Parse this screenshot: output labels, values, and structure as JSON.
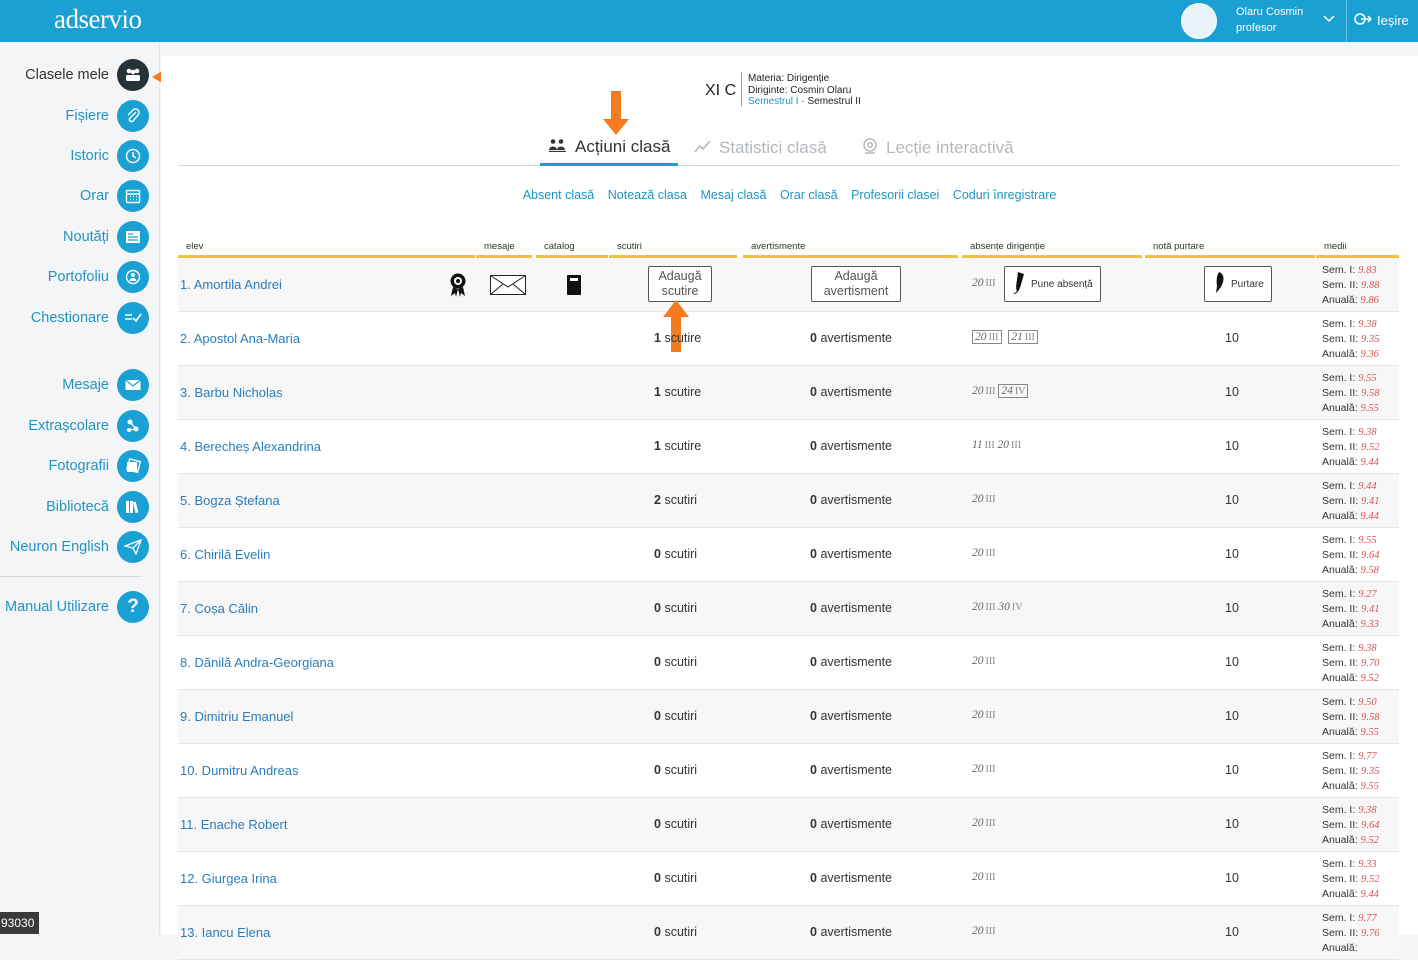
{
  "header": {
    "logo": "adservio",
    "user_name": "Olaru Cosmin",
    "user_role": "profesor",
    "logout": "Ieșire",
    "brand_color": "#1ba0d4"
  },
  "sidebar": {
    "items": [
      {
        "label": "Clasele mele",
        "icon": "classes-icon",
        "active": true
      },
      {
        "label": "Fișiere",
        "icon": "paperclip-icon"
      },
      {
        "label": "Istoric",
        "icon": "history-icon"
      },
      {
        "label": "Orar",
        "icon": "calendar-icon"
      },
      {
        "label": "Noutăți",
        "icon": "news-icon"
      },
      {
        "label": "Portofoliu",
        "icon": "portfolio-icon"
      },
      {
        "label": "Chestionare",
        "icon": "quiz-icon"
      },
      {
        "label": "Mesaje",
        "icon": "mail-icon"
      },
      {
        "label": "Extrașcolare",
        "icon": "extracurricular-icon"
      },
      {
        "label": "Fotografii",
        "icon": "photo-icon"
      },
      {
        "label": "Bibliotecă",
        "icon": "library-icon"
      },
      {
        "label": "Neuron English",
        "icon": "paper-plane-icon"
      },
      {
        "label": "Manual Utilizare",
        "icon": "help-icon"
      }
    ]
  },
  "class_info": {
    "name": "XI C",
    "subject": "Materia: Dirigenție",
    "head_teacher": "Diriginte: Cosmin Olaru",
    "semester_1": "Semestrul I",
    "separator": " · ",
    "semester_2": "Semestrul II"
  },
  "tabs": [
    {
      "label": "Acțiuni clasă",
      "active": true
    },
    {
      "label": "Statistici clasă"
    },
    {
      "label": "Lecție interactivă"
    }
  ],
  "sublinks": [
    "Absent clasă",
    "Notează clasa",
    "Mesaj clasă",
    "Orar clasă",
    "Profesorii clasei",
    "Coduri înregistrare"
  ],
  "table": {
    "headers": {
      "student": "elev",
      "messages": "mesaje",
      "catalog": "catalog",
      "exemptions": "scutiri",
      "warnings": "avertismente",
      "absences": "absențe dirigenție",
      "conduct": "notă purtare",
      "averages": "medii"
    },
    "buttons": {
      "add_exemption_1": "Adaugă",
      "add_exemption_2": "scutire",
      "add_warning_1": "Adaugă",
      "add_warning_2": "avertisment",
      "add_absence": "Pune absență",
      "conduct": "Purtare"
    },
    "avg_labels": {
      "s1": "Sem. I: ",
      "s2": "Sem. II: ",
      "an": "Anuală: "
    },
    "exemption_word_singular": "scutire",
    "exemption_word_plural": "scutiri",
    "warning_word": "avertismente",
    "rows": [
      {
        "name": "1. Amortila Andrei",
        "absences": [
          {
            "d": "20",
            "m": "III",
            "boxed": false
          }
        ],
        "s1": "9.83",
        "s2": "9.88",
        "an": "9.86"
      },
      {
        "name": "2. Apostol Ana-Maria",
        "exemptions": "1",
        "exemptions_label": "scutire",
        "warnings": "0",
        "absences": [
          {
            "d": "20",
            "m": "III",
            "boxed": true
          },
          {
            "d": "21",
            "m": "III",
            "boxed": true
          }
        ],
        "conduct": "10",
        "s1": "9.38",
        "s2": "9.35",
        "an": "9.36"
      },
      {
        "name": "3. Barbu Nicholas",
        "exemptions": "1",
        "exemptions_label": "scutire",
        "warnings": "0",
        "absences": [
          {
            "d": "20",
            "m": "III",
            "boxed": false
          },
          {
            "d": "24",
            "m": "IV",
            "boxed": true
          }
        ],
        "conduct": "10",
        "s1": "9.55",
        "s2": "9.58",
        "an": "9.55"
      },
      {
        "name": "4. Berecheș Alexandrina",
        "exemptions": "1",
        "exemptions_label": "scutire",
        "warnings": "0",
        "absences": [
          {
            "d": "11",
            "m": "III",
            "boxed": false
          },
          {
            "d": "20",
            "m": "III",
            "boxed": false
          }
        ],
        "conduct": "10",
        "s1": "9.38",
        "s2": "9.52",
        "an": "9.44"
      },
      {
        "name": "5. Bogza Ștefana",
        "exemptions": "2",
        "exemptions_label": "scutiri",
        "warnings": "0",
        "absences": [
          {
            "d": "20",
            "m": "III",
            "boxed": false
          }
        ],
        "conduct": "10",
        "s1": "9.44",
        "s2": "9.41",
        "an": "9.44"
      },
      {
        "name": "6. Chirilă Evelin",
        "exemptions": "0",
        "exemptions_label": "scutiri",
        "warnings": "0",
        "absences": [
          {
            "d": "20",
            "m": "III",
            "boxed": false
          }
        ],
        "conduct": "10",
        "s1": "9.55",
        "s2": "9.64",
        "an": "9.58"
      },
      {
        "name": "7. Coșa Călin",
        "exemptions": "0",
        "exemptions_label": "scutiri",
        "warnings": "0",
        "absences": [
          {
            "d": "20",
            "m": "III",
            "boxed": false
          },
          {
            "d": "30",
            "m": "IV",
            "boxed": false
          }
        ],
        "conduct": "10",
        "s1": "9.27",
        "s2": "9.41",
        "an": "9.33"
      },
      {
        "name": "8. Dănilă Andra-Georgiana",
        "exemptions": "0",
        "exemptions_label": "scutiri",
        "warnings": "0",
        "absences": [
          {
            "d": "20",
            "m": "III",
            "boxed": false
          }
        ],
        "conduct": "10",
        "s1": "9.38",
        "s2": "9.70",
        "an": "9.52"
      },
      {
        "name": "9. Dimitriu Emanuel",
        "exemptions": "0",
        "exemptions_label": "scutiri",
        "warnings": "0",
        "absences": [
          {
            "d": "20",
            "m": "III",
            "boxed": false
          }
        ],
        "conduct": "10",
        "s1": "9.50",
        "s2": "9.58",
        "an": "9.55"
      },
      {
        "name": "10. Dumitru Andreas",
        "exemptions": "0",
        "exemptions_label": "scutiri",
        "warnings": "0",
        "absences": [
          {
            "d": "20",
            "m": "III",
            "boxed": false
          }
        ],
        "conduct": "10",
        "s1": "9.77",
        "s2": "9.35",
        "an": "9.55"
      },
      {
        "name": "11. Enache Robert",
        "exemptions": "0",
        "exemptions_label": "scutiri",
        "warnings": "0",
        "absences": [
          {
            "d": "20",
            "m": "III",
            "boxed": false
          }
        ],
        "conduct": "10",
        "s1": "9.38",
        "s2": "9.64",
        "an": "9.52"
      },
      {
        "name": "12. Giurgea Irina",
        "exemptions": "0",
        "exemptions_label": "scutiri",
        "warnings": "0",
        "absences": [
          {
            "d": "20",
            "m": "III",
            "boxed": false
          }
        ],
        "conduct": "10",
        "s1": "9.33",
        "s2": "9.52",
        "an": "9.44"
      },
      {
        "name": "13. Iancu Elena",
        "exemptions": "0",
        "exemptions_label": "scutiri",
        "warnings": "0",
        "absences": [
          {
            "d": "20",
            "m": "III",
            "boxed": false
          }
        ],
        "conduct": "10",
        "s1": "9.77",
        "s2": "9.76",
        "an": ""
      }
    ]
  },
  "counter": "93030",
  "accent_arrow_color": "#f47b20"
}
